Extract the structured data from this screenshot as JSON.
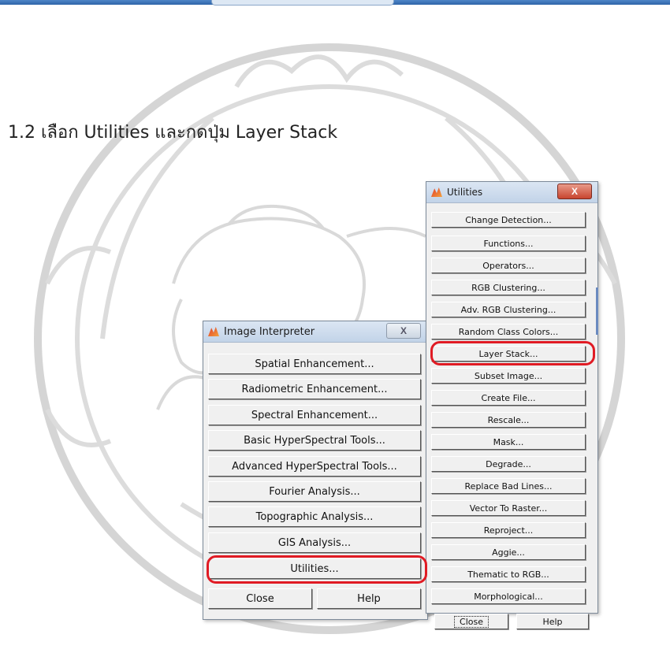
{
  "heading": "1.2  เลือก Utilities และกดปุ่ม  Layer Stack",
  "image_interpreter": {
    "title": "Image Interpreter",
    "close_glyph": "X",
    "buttons": [
      "Spatial Enhancement...",
      "Radiometric Enhancement...",
      "Spectral Enhancement...",
      "Basic HyperSpectral Tools...",
      "Advanced HyperSpectral Tools...",
      "Fourier Analysis...",
      "Topographic Analysis...",
      "GIS Analysis...",
      "Utilities..."
    ],
    "close_label": "Close",
    "help_label": "Help",
    "highlighted": "Utilities..."
  },
  "utilities": {
    "title": "Utilities",
    "close_glyph": "X",
    "buttons": [
      "Change Detection...",
      "Functions...",
      "Operators...",
      "RGB Clustering...",
      "Adv. RGB Clustering...",
      "Random Class Colors...",
      "Layer Stack...",
      "Subset Image...",
      "Create File...",
      "Rescale...",
      "Mask...",
      "Degrade...",
      "Replace Bad Lines...",
      "Vector To Raster...",
      "Reproject...",
      "Aggie...",
      "Thematic to RGB...",
      "Morphological..."
    ],
    "close_label": "Close",
    "help_label": "Help",
    "highlighted": "Layer Stack..."
  },
  "colors": {
    "highlight": "#e01b24",
    "watermark": "#d5d5d5"
  },
  "icons": [
    "app-icon",
    "close-icon",
    "watermark-emblem"
  ]
}
